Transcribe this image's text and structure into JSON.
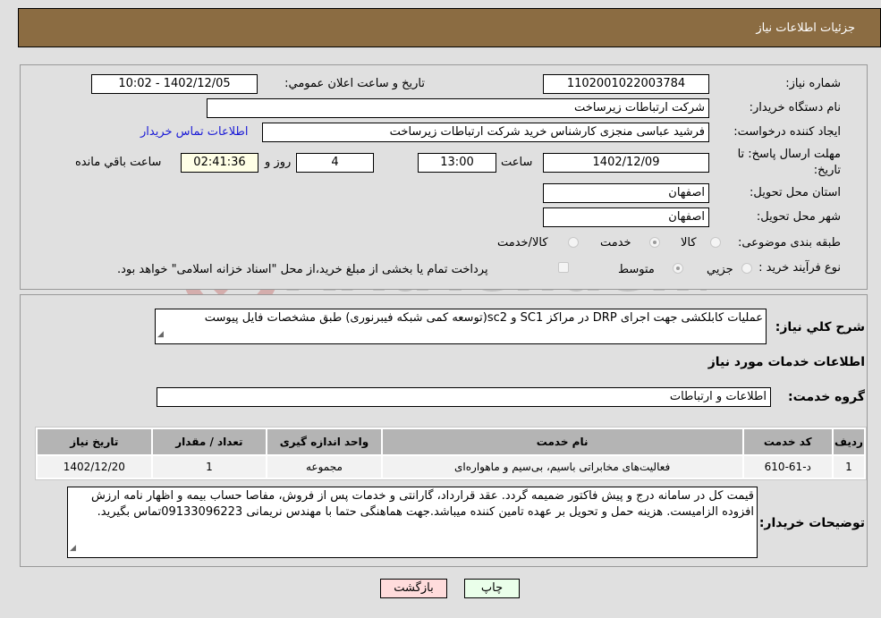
{
  "header": {
    "title": "جزئیات اطلاعات نیاز"
  },
  "fields": {
    "need_number_label": "شماره نیاز:",
    "need_number": "1102001022003784",
    "announce_label": "تاریخ و ساعت اعلان عمومي:",
    "announce_value": "1402/12/05 - 10:02",
    "buyer_org_label": "نام دستگاه خريدار:",
    "buyer_org": "شرکت ارتباطات زیرساخت",
    "creator_label": "ایجاد کننده درخواست:",
    "creator": "فرشید عباسی منجزی کارشناس خرید شرکت ارتباطات زیرساخت",
    "contact_link": "اطلاعات تماس خريدار",
    "deadline_label": "مهلت ارسال پاسخ: تا تاریخ:",
    "deadline_date": "1402/12/09",
    "time_label": "ساعت",
    "deadline_time": "13:00",
    "days_value": "4",
    "days_label": "روز و",
    "remaining_time": "02:41:36",
    "remaining_label": "ساعت باقي مانده",
    "province_label": "استان محل تحویل:",
    "province": "اصفهان",
    "city_label": "شهر محل تحویل:",
    "city": "اصفهان",
    "category_label": "طبقه بندی موضوعی:",
    "category_options": [
      "کالا",
      "خدمت",
      "کالا/خدمت"
    ],
    "category_selected": "خدمت",
    "process_label": "نوع فرآیند خرید :",
    "process_options": [
      "جزيي",
      "متوسط"
    ],
    "process_selected": "متوسط",
    "treasury_note": "پرداخت تمام یا بخشی از مبلغ خرید،از محل \"اسناد خزانه اسلامی\" خواهد بود."
  },
  "summary": {
    "label": "شرح کلي نياز:",
    "text": "عملیات کابلکشی جهت اجرای DRP در مراکز SC1 و sc2(توسعه کمی شبکه فیبرنوری) طبق مشخصات فایل پیوست"
  },
  "services": {
    "section_title": "اطلاعات خدمات مورد نياز",
    "group_label": "گروه خدمت:",
    "group_value": "اطلاعات و ارتباطات",
    "columns": [
      "رديف",
      "کد خدمت",
      "نام خدمت",
      "واحد اندازه گيری",
      "تعداد / مقدار",
      "تاريخ نياز"
    ],
    "rows": [
      [
        "1",
        "د-61-610",
        "فعالیت‌های مخابراتی باسیم، بی‌سیم و ماهواره‌ای",
        "مجموعه",
        "1",
        "1402/12/20"
      ]
    ]
  },
  "buyer_notes": {
    "label": "توضيحات خريدار:",
    "text": "قیمت کل در سامانه درج و پیش فاکتور ضمیمه گردد. عقد قرارداد، گارانتی و خدمات پس از فروش، مفاصا حساب بیمه و اظهار نامه ارزش افزوده الزامیست. هزینه حمل و تحویل بر عهده تامین کننده میباشد.جهت هماهنگی حتما با مهندس نریمانی 09133096223تماس بگیرید."
  },
  "buttons": {
    "print": "چاپ",
    "back": "بازگشت"
  },
  "watermark": {
    "text": "AriaTender.neT"
  }
}
